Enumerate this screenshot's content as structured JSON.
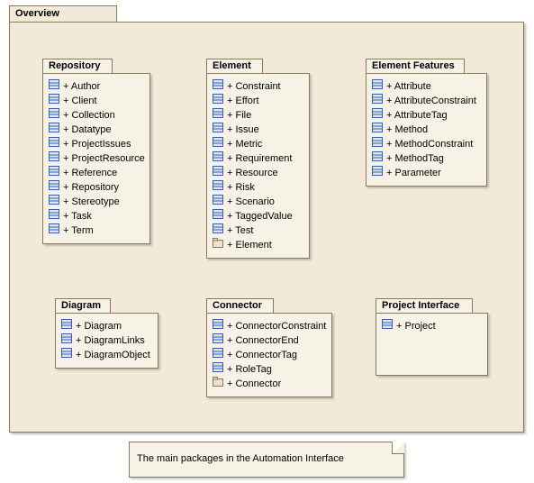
{
  "overview": {
    "title": "Overview"
  },
  "note": {
    "text": "The main packages in the Automation Interface"
  },
  "packages": {
    "repository": {
      "title": "Repository",
      "items": [
        {
          "icon": "class",
          "label": "+ Author"
        },
        {
          "icon": "class",
          "label": "+ Client"
        },
        {
          "icon": "class",
          "label": "+ Collection"
        },
        {
          "icon": "class",
          "label": "+ Datatype"
        },
        {
          "icon": "class",
          "label": "+ ProjectIssues"
        },
        {
          "icon": "class",
          "label": "+ ProjectResource"
        },
        {
          "icon": "class",
          "label": "+ Reference"
        },
        {
          "icon": "class",
          "label": "+ Repository"
        },
        {
          "icon": "class",
          "label": "+ Stereotype"
        },
        {
          "icon": "class",
          "label": "+ Task"
        },
        {
          "icon": "class",
          "label": "+ Term"
        }
      ]
    },
    "element": {
      "title": "Element",
      "items": [
        {
          "icon": "class",
          "label": "+ Constraint"
        },
        {
          "icon": "class",
          "label": "+ Effort"
        },
        {
          "icon": "class",
          "label": "+ File"
        },
        {
          "icon": "class",
          "label": "+ Issue"
        },
        {
          "icon": "class",
          "label": "+ Metric"
        },
        {
          "icon": "class",
          "label": "+ Requirement"
        },
        {
          "icon": "class",
          "label": "+ Resource"
        },
        {
          "icon": "class",
          "label": "+ Risk"
        },
        {
          "icon": "class",
          "label": "+ Scenario"
        },
        {
          "icon": "class",
          "label": "+ TaggedValue"
        },
        {
          "icon": "class",
          "label": "+ Test"
        },
        {
          "icon": "pkg",
          "label": "+ Element"
        }
      ]
    },
    "elementFeatures": {
      "title": "Element Features",
      "items": [
        {
          "icon": "class",
          "label": "+ Attribute"
        },
        {
          "icon": "class",
          "label": "+ AttributeConstraint"
        },
        {
          "icon": "class",
          "label": "+ AttributeTag"
        },
        {
          "icon": "class",
          "label": "+ Method"
        },
        {
          "icon": "class",
          "label": "+ MethodConstraint"
        },
        {
          "icon": "class",
          "label": "+ MethodTag"
        },
        {
          "icon": "class",
          "label": "+ Parameter"
        }
      ]
    },
    "diagram": {
      "title": "Diagram",
      "items": [
        {
          "icon": "class",
          "label": "+ Diagram"
        },
        {
          "icon": "class",
          "label": "+ DiagramLinks"
        },
        {
          "icon": "class",
          "label": "+ DiagramObject"
        }
      ]
    },
    "connector": {
      "title": "Connector",
      "items": [
        {
          "icon": "class",
          "label": "+ ConnectorConstraint"
        },
        {
          "icon": "class",
          "label": "+ ConnectorEnd"
        },
        {
          "icon": "class",
          "label": "+ ConnectorTag"
        },
        {
          "icon": "class",
          "label": "+ RoleTag"
        },
        {
          "icon": "pkg",
          "label": "+ Connector"
        }
      ]
    },
    "projectInterface": {
      "title": "Project Interface",
      "items": [
        {
          "icon": "class",
          "label": "+ Project"
        }
      ]
    }
  }
}
